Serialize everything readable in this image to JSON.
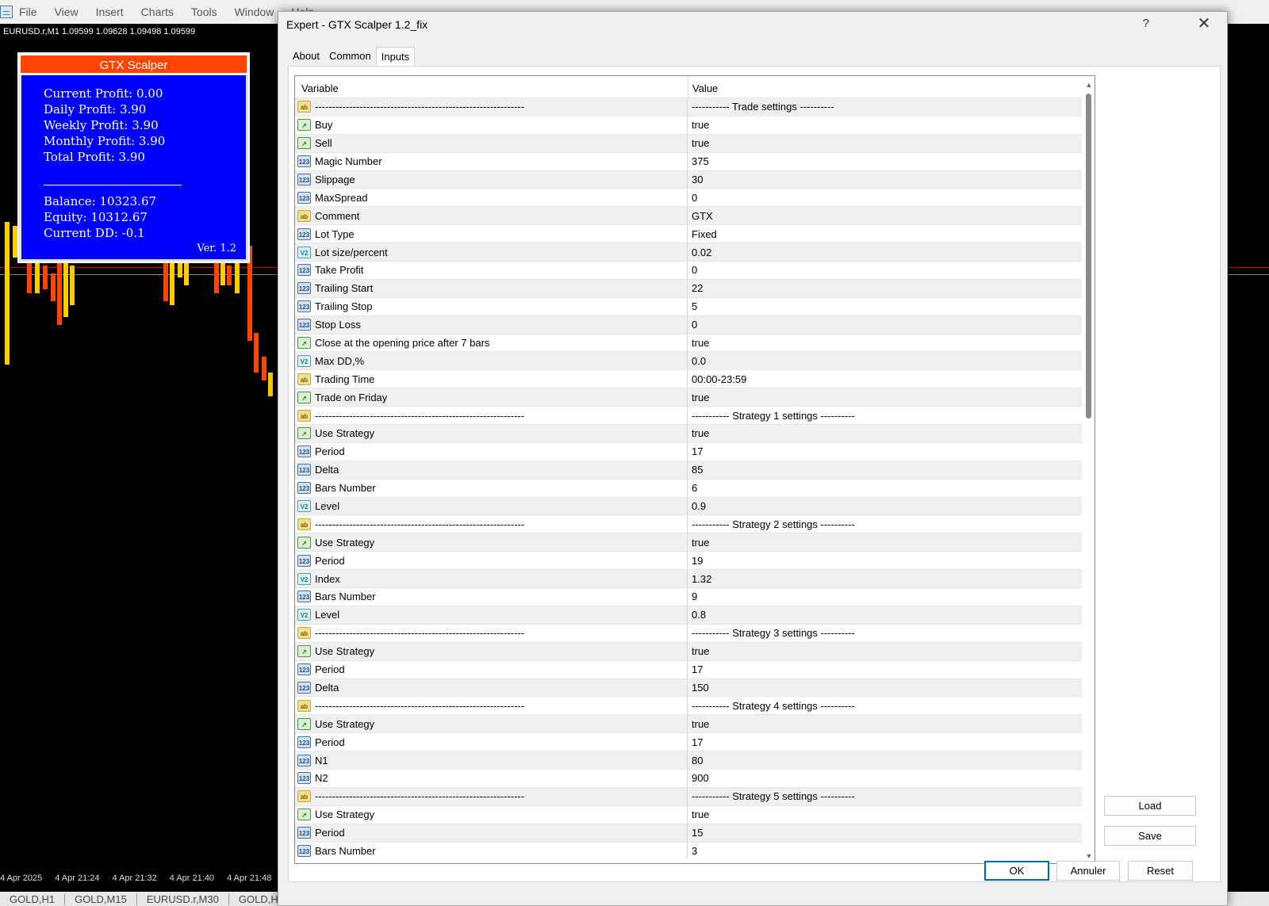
{
  "menu": [
    "File",
    "View",
    "Insert",
    "Charts",
    "Tools",
    "Window",
    "Help"
  ],
  "chart": {
    "symbol": "EURUSD.r,M1  1.09599 1.09628 1.09498 1.09599",
    "time_labels": [
      "4 Apr 2025",
      "4 Apr 21:24",
      "4 Apr 21:32",
      "4 Apr 21:40",
      "4 Apr 21:48"
    ],
    "tabs": [
      "GOLD,H1",
      "GOLD,M15",
      "EURUSD.r,M30",
      "GOLD,H"
    ]
  },
  "gtx": {
    "title": "GTX Scalper",
    "current_profit": "Current Profit:    0.00",
    "daily_profit": "Daily Profit:        3.90",
    "weekly_profit": "Weekly Profit:    3.90",
    "monthly_profit": "Monthly Profit:  3.90",
    "total_profit": "Total Profit:       3.90",
    "balance": "Balance: 10323.67",
    "equity": "Equity: 10312.67",
    "current_dd": "Current DD: -0.1",
    "version": "Ver. 1.2"
  },
  "dialog": {
    "title": "Expert - GTX Scalper 1.2_fix",
    "help": "?",
    "tabs": [
      "About",
      "Common",
      "Inputs"
    ],
    "active_tab": "Inputs",
    "col_variable": "Variable",
    "col_value": "Value",
    "buttons": {
      "load": "Load",
      "save": "Save",
      "ok": "OK",
      "cancel": "Annuler",
      "reset": "Reset"
    }
  },
  "inputs": [
    {
      "icon": "str",
      "name": "-------------------------------------------------------------",
      "value": "----------- Trade settings ----------"
    },
    {
      "icon": "bool",
      "name": "Buy",
      "value": "true"
    },
    {
      "icon": "bool",
      "name": "Sell",
      "value": "true"
    },
    {
      "icon": "int",
      "name": "Magic Number",
      "value": "375"
    },
    {
      "icon": "int",
      "name": "Slippage",
      "value": "30"
    },
    {
      "icon": "int",
      "name": "MaxSpread",
      "value": "0"
    },
    {
      "icon": "str",
      "name": "Comment",
      "value": "GTX"
    },
    {
      "icon": "int",
      "name": "Lot Type",
      "value": "Fixed"
    },
    {
      "icon": "dbl",
      "name": "Lot size/percent",
      "value": "0.02"
    },
    {
      "icon": "int",
      "name": "Take Profit",
      "value": "0"
    },
    {
      "icon": "int",
      "name": "Trailing Start",
      "value": "22"
    },
    {
      "icon": "int",
      "name": "Trailing Stop",
      "value": "5"
    },
    {
      "icon": "int",
      "name": "Stop Loss",
      "value": "0"
    },
    {
      "icon": "bool",
      "name": "Close at the opening price after 7 bars",
      "value": "true"
    },
    {
      "icon": "dbl",
      "name": "Max DD,%",
      "value": "0.0"
    },
    {
      "icon": "str",
      "name": "Trading Time",
      "value": "00:00-23:59"
    },
    {
      "icon": "bool",
      "name": "Trade on Friday",
      "value": "true"
    },
    {
      "icon": "str",
      "name": "-------------------------------------------------------------",
      "value": "----------- Strategy 1 settings ----------"
    },
    {
      "icon": "bool",
      "name": "Use Strategy",
      "value": "true"
    },
    {
      "icon": "int",
      "name": "Period",
      "value": "17"
    },
    {
      "icon": "int",
      "name": "Delta",
      "value": "85"
    },
    {
      "icon": "int",
      "name": "Bars Number",
      "value": "6"
    },
    {
      "icon": "dbl",
      "name": "Level",
      "value": "0.9"
    },
    {
      "icon": "str",
      "name": "-------------------------------------------------------------",
      "value": "----------- Strategy 2 settings ----------"
    },
    {
      "icon": "bool",
      "name": "Use Strategy",
      "value": "true"
    },
    {
      "icon": "int",
      "name": "Period",
      "value": "19"
    },
    {
      "icon": "dbl",
      "name": "Index",
      "value": "1.32"
    },
    {
      "icon": "int",
      "name": "Bars Number",
      "value": "9"
    },
    {
      "icon": "dbl",
      "name": "Level",
      "value": "0.8"
    },
    {
      "icon": "str",
      "name": "-------------------------------------------------------------",
      "value": "----------- Strategy 3 settings ----------"
    },
    {
      "icon": "bool",
      "name": "Use Strategy",
      "value": "true"
    },
    {
      "icon": "int",
      "name": "Period",
      "value": "17"
    },
    {
      "icon": "int",
      "name": "Delta",
      "value": "150"
    },
    {
      "icon": "str",
      "name": "-------------------------------------------------------------",
      "value": "----------- Strategy 4 settings ----------"
    },
    {
      "icon": "bool",
      "name": "Use Strategy",
      "value": "true"
    },
    {
      "icon": "int",
      "name": "Period",
      "value": "17"
    },
    {
      "icon": "int",
      "name": "N1",
      "value": "80"
    },
    {
      "icon": "int",
      "name": "N2",
      "value": "900"
    },
    {
      "icon": "str",
      "name": "-------------------------------------------------------------",
      "value": "----------- Strategy 5 settings ----------"
    },
    {
      "icon": "bool",
      "name": "Use Strategy",
      "value": "true"
    },
    {
      "icon": "int",
      "name": "Period",
      "value": "15"
    },
    {
      "icon": "int",
      "name": "Bars Number",
      "value": "3"
    }
  ],
  "colors": {
    "panel_header": "#ff4500",
    "panel_body": "#0000ff",
    "bull_candle": "#ffcc00",
    "bear_candle": "#ff4500",
    "ok_border": "#0067c0"
  }
}
